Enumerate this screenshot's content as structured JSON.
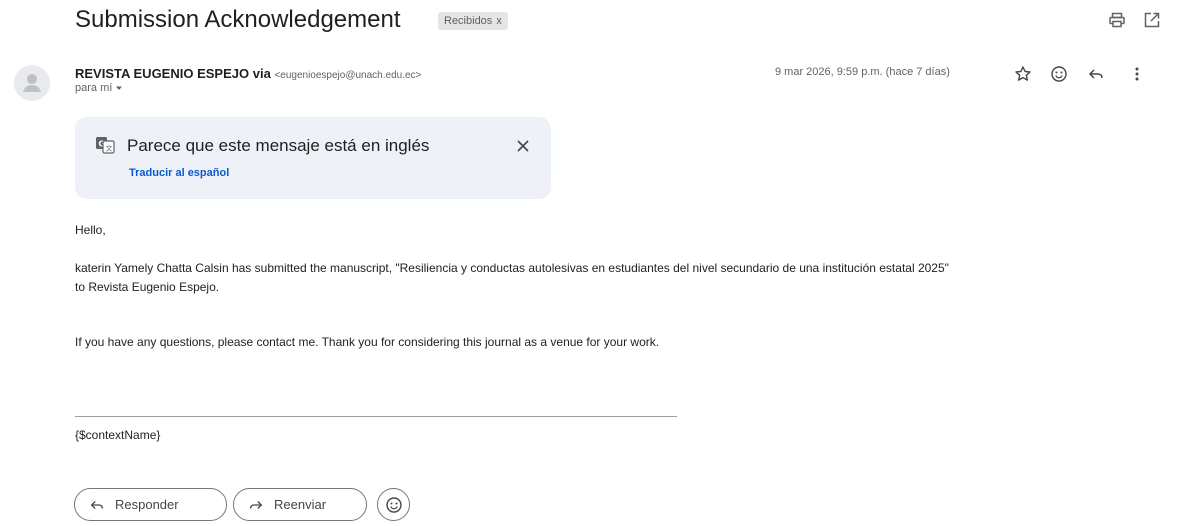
{
  "subject": "Submission Acknowledgement",
  "label_chip": {
    "text": "Recibidos",
    "remove": "x"
  },
  "sender": {
    "name": "REVISTA EUGENIO ESPEJO",
    "via": "via",
    "email": "<eugenioespejo@unach.edu.ec>",
    "recipient": "para mí"
  },
  "date": "9 mar 2026, 9:59 p.m. (hace 7 días)",
  "translate": {
    "message": "Parece que este mensaje está en inglés",
    "link": "Traducir al español"
  },
  "body": {
    "greeting": "Hello,",
    "line1": "katerin Yamely Chatta Calsin has submitted the manuscript, \"Resiliencia y conductas autolesivas en estudiantes del nivel secundario de una institución estatal 2025\"",
    "line2": "to Revista Eugenio Espejo.",
    "line3": "If you have any questions, please contact me. Thank you for considering this journal as a venue for your work.",
    "signature": "{$contextName}"
  },
  "actions": {
    "reply": "Responder",
    "forward": "Reenviar"
  },
  "icons": {
    "print": "print-icon",
    "open_new_window": "open-in-new-window-icon",
    "star": "star-icon",
    "emoji": "emoji-icon",
    "reply": "reply-icon",
    "more": "more-vert-icon",
    "translate": "translate-icon",
    "close": "close-icon",
    "avatar": "person-icon",
    "forward": "forward-icon",
    "dropdown": "chevron-down-icon"
  },
  "colors": {
    "link_blue": "#0b57d0",
    "banner_bg": "#eef2f8",
    "chip_bg": "#e5e5e5"
  }
}
